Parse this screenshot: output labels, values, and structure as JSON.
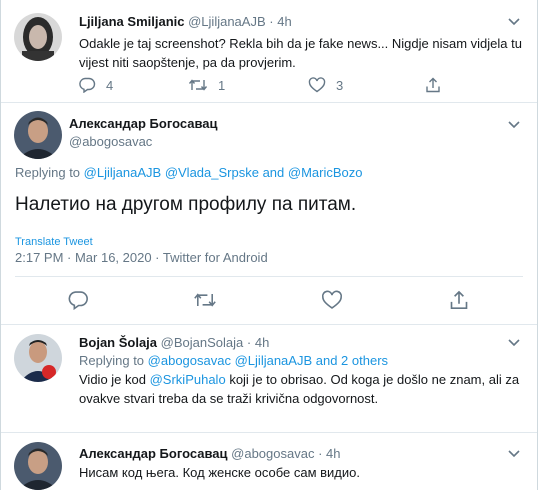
{
  "tweet1": {
    "name": "Ljiljana Smiljanic",
    "handle": "@LjiljanaAJB",
    "sep": "·",
    "time": "4h",
    "text_line1": "Odakle je taj screenshot? Rekla bih da je fake news... Nigdje nisam vidjela tu",
    "text_line2": "vijest niti saopštenje, pa da provjerim.",
    "replies": "4",
    "retweets": "1",
    "likes": "3"
  },
  "main_tweet": {
    "name": "Александар Богосавац",
    "handle": "@abogosavac",
    "replying_label": "Replying to",
    "mention1": "@LjiljanaAJB",
    "mention2": "@Vlada_Srpske",
    "and_label": "and",
    "mention3": "@MaricBozo",
    "text": "Налетио на другом профилу па питам.",
    "translate": "Translate Tweet",
    "timestamp": "2:17 PM · Mar 16, 2020 ·",
    "source": "Twitter for Android"
  },
  "tweet3": {
    "name": "Bojan Šolaja",
    "handle": "@BojanSolaja",
    "sep": "·",
    "time": "4h",
    "replying_label": "Replying to",
    "mention1": "@abogosavac",
    "mention2": "@LjiljanaAJB",
    "and_others": "and 2 others",
    "text_pre": "Vidio je kod",
    "text_mention": "@SrkiPuhalo",
    "text_post": "koji je to obrisao. Od koga je došlo ne znam, ali za",
    "text_line2": "ovakve stvari treba da se traži krivična odgovornost."
  },
  "tweet4": {
    "name": "Александар Богосавац",
    "handle": "@abogosavac",
    "sep": "·",
    "time": "4h",
    "text": "Нисам код њега. Код женске особе сам видио."
  },
  "colors": {
    "link": "#1b95e0",
    "muted": "#657786",
    "text": "#14171a",
    "divider": "#e1e8ed"
  }
}
